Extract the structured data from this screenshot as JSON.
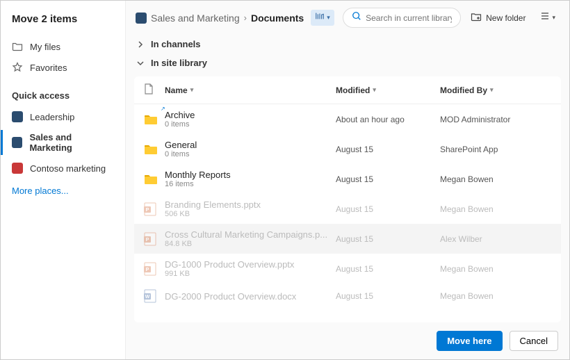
{
  "title": "Move 2 items",
  "nav": {
    "myfiles": "My files",
    "favorites": "Favorites"
  },
  "quickaccess": {
    "label": "Quick access",
    "items": [
      {
        "label": "Leadership",
        "color": "#2b4c6f"
      },
      {
        "label": "Sales and Marketing",
        "color": "#2b4c6f"
      },
      {
        "label": "Contoso marketing",
        "color": "#c93838"
      }
    ],
    "more": "More places..."
  },
  "breadcrumb": {
    "parent": "Sales and Marketing",
    "current": "Documents"
  },
  "search": {
    "placeholder": "Search in current library"
  },
  "toolbar": {
    "new_folder": "New folder"
  },
  "sections": {
    "channels": "In channels",
    "library": "In site library"
  },
  "columns": {
    "name": "Name",
    "modified": "Modified",
    "modified_by": "Modified By"
  },
  "rows": [
    {
      "name": "Archive",
      "sub": "0 items",
      "modified": "About an hour ago",
      "by": "MOD Administrator",
      "type": "folder",
      "shortcut": true
    },
    {
      "name": "General",
      "sub": "0 items",
      "modified": "August 15",
      "by": "SharePoint App",
      "type": "folder"
    },
    {
      "name": "Monthly Reports",
      "sub": "16 items",
      "modified": "August 15",
      "by": "Megan Bowen",
      "type": "folder"
    },
    {
      "name": "Branding Elements.pptx",
      "sub": "506 KB",
      "modified": "August 15",
      "by": "Megan Bowen",
      "type": "pptx",
      "faded": true
    },
    {
      "name": "Cross Cultural Marketing Campaigns.p...",
      "sub": "84.8 KB",
      "modified": "August 15",
      "by": "Alex Wilber",
      "type": "pptx",
      "faded": true,
      "hover": true
    },
    {
      "name": "DG-1000 Product Overview.pptx",
      "sub": "991 KB",
      "modified": "August 15",
      "by": "Megan Bowen",
      "type": "pptx",
      "faded": true
    },
    {
      "name": "DG-2000 Product Overview.docx",
      "sub": "",
      "modified": "August 15",
      "by": "Megan Bowen",
      "type": "docx",
      "faded": true
    }
  ],
  "footer": {
    "primary": "Move here",
    "cancel": "Cancel"
  }
}
